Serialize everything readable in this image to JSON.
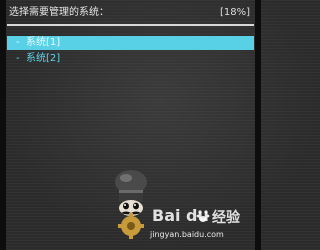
{
  "header": {
    "title": "选择需要管理的系统：",
    "progress": "[18%]"
  },
  "menu": {
    "items": [
      {
        "prefix": "-",
        "label": "系统[1]",
        "selected": true
      },
      {
        "prefix": "-",
        "label": "系统[2]",
        "selected": false
      }
    ]
  },
  "splash": {
    "icon": "chef-hat-icon"
  },
  "watermark": {
    "logo": "Bai du",
    "brand": "经验",
    "url": "jingyan.baidu.com"
  },
  "colors": {
    "accent": "#58d0e6",
    "background": "#2b2b2b",
    "text": "#e6e6e6"
  }
}
